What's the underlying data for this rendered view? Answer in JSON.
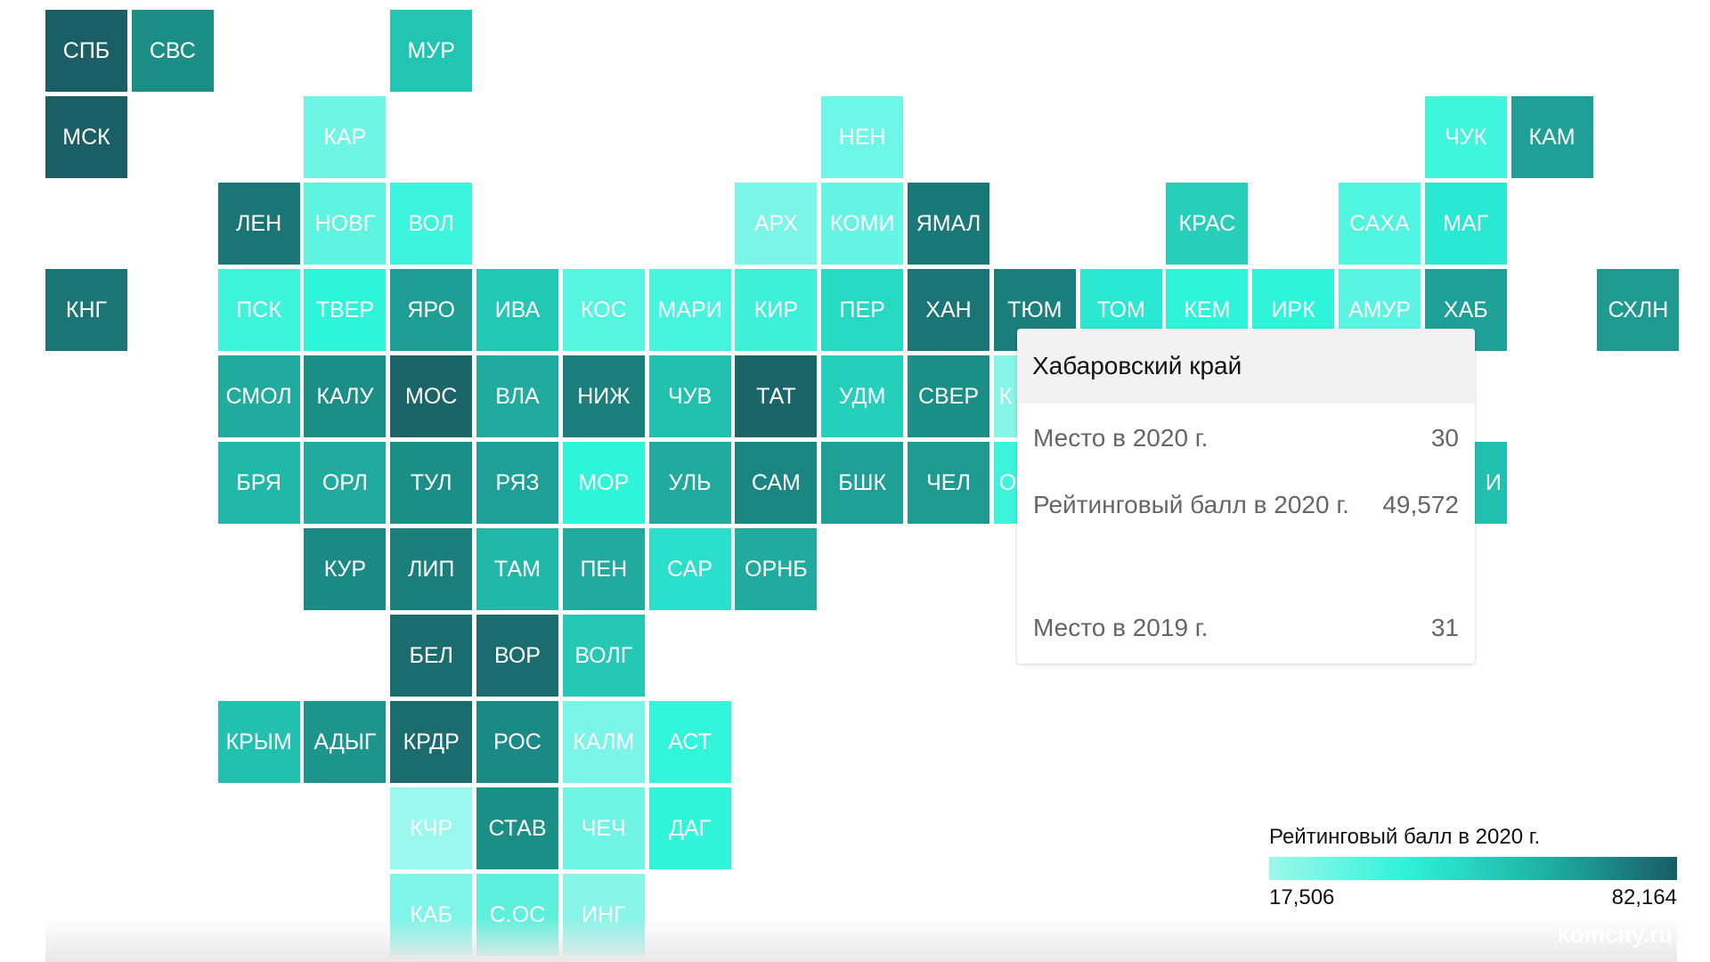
{
  "chart_data": {
    "type": "heatmap",
    "subtype": "tile-grid-map",
    "legend": {
      "title": "Рейтинговый балл в 2020 г.",
      "min_label": "17,506",
      "max_label": "82,164",
      "min": 17.506,
      "max": 82.164,
      "colors": [
        "#9ef8ea",
        "#2ef3d9",
        "#20b3a4",
        "#1a5c66"
      ],
      "placement": "bottom-right"
    },
    "tiles": [
      {
        "label": "СПБ",
        "col": 0,
        "row": 0,
        "color": "#1b5f66"
      },
      {
        "label": "СВС",
        "col": 1,
        "row": 0,
        "color": "#1b8f86"
      },
      {
        "label": "МУР",
        "col": 4,
        "row": 0,
        "color": "#22c5b2"
      },
      {
        "label": "МСК",
        "col": 0,
        "row": 1,
        "color": "#1b5f66"
      },
      {
        "label": "КАР",
        "col": 3,
        "row": 1,
        "color": "#6ff5e4"
      },
      {
        "label": "НЕН",
        "col": 9,
        "row": 1,
        "color": "#6ef7e6"
      },
      {
        "label": "ЧУК",
        "col": 16,
        "row": 1,
        "color": "#3ff5dc"
      },
      {
        "label": "КАМ",
        "col": 17,
        "row": 1,
        "color": "#1ea096"
      },
      {
        "label": "ЛЕН",
        "col": 2,
        "row": 2,
        "color": "#1b7575"
      },
      {
        "label": "НОВГ",
        "col": 3,
        "row": 2,
        "color": "#5ef4e0"
      },
      {
        "label": "ВОЛ",
        "col": 4,
        "row": 2,
        "color": "#3cf5dc"
      },
      {
        "label": "АРХ",
        "col": 8,
        "row": 2,
        "color": "#7af5e6"
      },
      {
        "label": "КОМИ",
        "col": 9,
        "row": 2,
        "color": "#66f5e4"
      },
      {
        "label": "ЯМАЛ",
        "col": 10,
        "row": 2,
        "color": "#1b7878"
      },
      {
        "label": "КРАС",
        "col": 13,
        "row": 2,
        "color": "#27cfbb"
      },
      {
        "label": "САХА",
        "col": 15,
        "row": 2,
        "color": "#50f5e0"
      },
      {
        "label": "МАГ",
        "col": 16,
        "row": 2,
        "color": "#2ae8d2"
      },
      {
        "label": "КНГ",
        "col": 0,
        "row": 3,
        "color": "#1b7575"
      },
      {
        "label": "ПСК",
        "col": 2,
        "row": 3,
        "color": "#3ef5dc"
      },
      {
        "label": "ТВЕР",
        "col": 3,
        "row": 3,
        "color": "#2ef5da"
      },
      {
        "label": "ЯРО",
        "col": 4,
        "row": 3,
        "color": "#1e9e94"
      },
      {
        "label": "ИВА",
        "col": 5,
        "row": 3,
        "color": "#23c8b4"
      },
      {
        "label": "КОС",
        "col": 6,
        "row": 3,
        "color": "#55f5e0"
      },
      {
        "label": "МАРИ",
        "col": 7,
        "row": 3,
        "color": "#45f5de"
      },
      {
        "label": "КИР",
        "col": 8,
        "row": 3,
        "color": "#3ef0d8"
      },
      {
        "label": "ПЕР",
        "col": 9,
        "row": 3,
        "color": "#27d8c2"
      },
      {
        "label": "ХАН",
        "col": 10,
        "row": 3,
        "color": "#1b7575"
      },
      {
        "label": "ТЮМ",
        "col": 11,
        "row": 3,
        "color": "#1b7f7c"
      },
      {
        "label": "ТОМ",
        "col": 12,
        "row": 3,
        "color": "#2ae8d2"
      },
      {
        "label": "КЕМ",
        "col": 13,
        "row": 3,
        "color": "#2ef5da"
      },
      {
        "label": "ИРК",
        "col": 14,
        "row": 3,
        "color": "#2ef5da"
      },
      {
        "label": "АМУР",
        "col": 15,
        "row": 3,
        "color": "#5af5e2"
      },
      {
        "label": "ХАБ",
        "col": 16,
        "row": 3,
        "color": "#1ea096"
      },
      {
        "label": "СХЛН",
        "col": 18,
        "row": 3,
        "color": "#1e9a90"
      },
      {
        "label": "СМОЛ",
        "col": 2,
        "row": 4,
        "color": "#20ab9e"
      },
      {
        "label": "КАЛУ",
        "col": 3,
        "row": 4,
        "color": "#1b8f86"
      },
      {
        "label": "МОС",
        "col": 4,
        "row": 4,
        "color": "#1b6468"
      },
      {
        "label": "ВЛА",
        "col": 5,
        "row": 4,
        "color": "#20ab9e"
      },
      {
        "label": "НИЖ",
        "col": 6,
        "row": 4,
        "color": "#1b7f7c"
      },
      {
        "label": "ЧУВ",
        "col": 7,
        "row": 4,
        "color": "#22c0ae"
      },
      {
        "label": "ТАТ",
        "col": 8,
        "row": 4,
        "color": "#1b6468"
      },
      {
        "label": "УДМ",
        "col": 9,
        "row": 4,
        "color": "#24d0bc"
      },
      {
        "label": "СВЕР",
        "col": 10,
        "row": 4,
        "color": "#1b8f86"
      },
      {
        "label": "К",
        "col": 11,
        "row": 4,
        "color": "#88f5e8",
        "align": "left"
      },
      {
        "label": "БРЯ",
        "col": 2,
        "row": 5,
        "color": "#22b8a8"
      },
      {
        "label": "ОРЛ",
        "col": 3,
        "row": 5,
        "color": "#20ab9e"
      },
      {
        "label": "ТУЛ",
        "col": 4,
        "row": 5,
        "color": "#1b8f86"
      },
      {
        "label": "РЯЗ",
        "col": 5,
        "row": 5,
        "color": "#1ea096"
      },
      {
        "label": "МОР",
        "col": 6,
        "row": 5,
        "color": "#2ef5da"
      },
      {
        "label": "УЛЬ",
        "col": 7,
        "row": 5,
        "color": "#20ab9e"
      },
      {
        "label": "САМ",
        "col": 8,
        "row": 5,
        "color": "#1b8582"
      },
      {
        "label": "БШК",
        "col": 9,
        "row": 5,
        "color": "#1ea096"
      },
      {
        "label": "ЧЕЛ",
        "col": 10,
        "row": 5,
        "color": "#1e9a90"
      },
      {
        "label": "О",
        "col": 11,
        "row": 5,
        "color": "#3ef5dc",
        "align": "left"
      },
      {
        "label": "И",
        "col": 16,
        "row": 5,
        "color": "#22c0ae",
        "align": "right"
      },
      {
        "label": "КУР",
        "col": 3,
        "row": 6,
        "color": "#1b8a84"
      },
      {
        "label": "ЛИП",
        "col": 4,
        "row": 6,
        "color": "#1b7f7c"
      },
      {
        "label": "ТАМ",
        "col": 5,
        "row": 6,
        "color": "#22b8a8"
      },
      {
        "label": "ПЕН",
        "col": 6,
        "row": 6,
        "color": "#20ab9e"
      },
      {
        "label": "САР",
        "col": 7,
        "row": 6,
        "color": "#2ae0cc"
      },
      {
        "label": "ОРНБ",
        "col": 8,
        "row": 6,
        "color": "#20ab9e"
      },
      {
        "label": "БЕЛ",
        "col": 4,
        "row": 7,
        "color": "#1b6c6e"
      },
      {
        "label": "ВОР",
        "col": 5,
        "row": 7,
        "color": "#1b6c6e"
      },
      {
        "label": "ВОЛГ",
        "col": 6,
        "row": 7,
        "color": "#24c8b5"
      },
      {
        "label": "КРЫМ",
        "col": 2,
        "row": 8,
        "color": "#22c0ae"
      },
      {
        "label": "АДЫГ",
        "col": 3,
        "row": 8,
        "color": "#1e958c"
      },
      {
        "label": "КРДР",
        "col": 4,
        "row": 8,
        "color": "#1b6c6e"
      },
      {
        "label": "РОС",
        "col": 5,
        "row": 8,
        "color": "#1b8a84"
      },
      {
        "label": "КАЛМ",
        "col": 6,
        "row": 8,
        "color": "#7af5e8"
      },
      {
        "label": "АСТ",
        "col": 7,
        "row": 8,
        "color": "#33f5dc"
      },
      {
        "label": "КЧР",
        "col": 4,
        "row": 9,
        "color": "#9af8ee"
      },
      {
        "label": "СТАВ",
        "col": 5,
        "row": 9,
        "color": "#1b8f86"
      },
      {
        "label": "ЧЕЧ",
        "col": 6,
        "row": 9,
        "color": "#70f5e4"
      },
      {
        "label": "ДАГ",
        "col": 7,
        "row": 9,
        "color": "#30f5da"
      },
      {
        "label": "КАБ",
        "col": 4,
        "row": 10,
        "color": "#7ef5e8"
      },
      {
        "label": "С.ОС",
        "col": 5,
        "row": 10,
        "color": "#5ef0dc"
      },
      {
        "label": "ИНГ",
        "col": 6,
        "row": 10,
        "color": "#88f5e8"
      }
    ]
  },
  "tooltip": {
    "title": "Хабаровский край",
    "rows": [
      {
        "label": "Место в 2020 г.",
        "value": "30"
      },
      {
        "label": "Рейтинговый балл в 2020 г.",
        "value": "49,572"
      },
      {
        "label": "Место в 2019 г.",
        "value": "31"
      }
    ]
  },
  "watermark": "komcity.ru"
}
